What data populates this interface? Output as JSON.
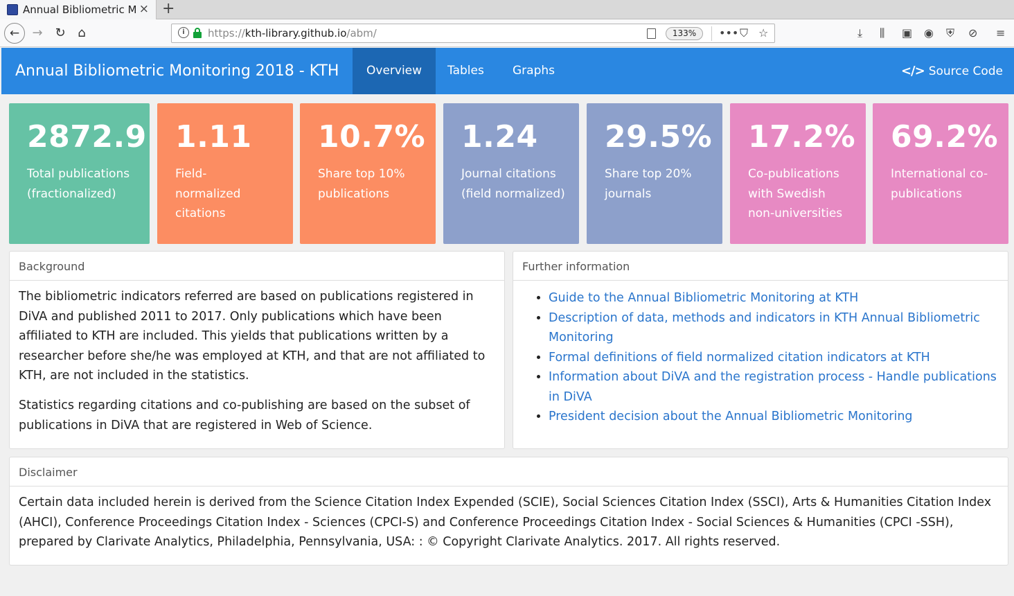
{
  "browser": {
    "tab_title": "Annual Bibliometric Monitoring 2018 - KTH",
    "tab_close": "×",
    "new_tab": "+",
    "url_scheme": "https://",
    "url_host": "kth-library.github.io",
    "url_path": "/abm/",
    "zoom": "133%"
  },
  "navbar": {
    "brand": "Annual Bibliometric Monitoring 2018 - KTH",
    "tabs": [
      {
        "label": "Overview",
        "active": true
      },
      {
        "label": "Tables",
        "active": false
      },
      {
        "label": "Graphs",
        "active": false
      }
    ],
    "source_code_label": "Source Code"
  },
  "value_boxes": [
    {
      "value": "2872.9",
      "label": "Total publications (fractionalized)",
      "color": "#66c2a5"
    },
    {
      "value": "1.11",
      "label": "Field-normalized citations",
      "color": "#fc8d62"
    },
    {
      "value": "10.7%",
      "label": "Share top 10% publications",
      "color": "#fc8d62"
    },
    {
      "value": "1.24",
      "label": "Journal citations (field normalized)",
      "color": "#8da0cb"
    },
    {
      "value": "29.5%",
      "label": "Share top 20% journals",
      "color": "#8da0cb"
    },
    {
      "value": "17.2%",
      "label": "Co-publications with Swedish non-universities",
      "color": "#e78ac3"
    },
    {
      "value": "69.2%",
      "label": "International co-publications",
      "color": "#e78ac3"
    }
  ],
  "background": {
    "heading": "Background",
    "paragraphs": [
      "The bibliometric indicators referred are based on publications registered in DiVA and published 2011 to 2017. Only publications which have been affiliated to KTH are included. This yields that publications written by a researcher before she/he was employed at KTH, and that are not affiliated to KTH, are not included in the statistics.",
      "Statistics regarding citations and co-publishing are based on the subset of publications in DiVA that are registered in Web of Science."
    ]
  },
  "further_info": {
    "heading": "Further information",
    "links": [
      "Guide to the Annual Bibliometric Monitoring at KTH",
      "Description of data, methods and indicators in KTH Annual Bibliometric Monitoring",
      "Formal definitions of field normalized citation indicators at KTH",
      "Information about DiVA and the registration process - Handle publications in DiVA",
      "President decision about the Annual Bibliometric Monitoring"
    ]
  },
  "disclaimer": {
    "heading": "Disclaimer",
    "text": "Certain data included herein is derived from the Science Citation Index Expended (SCIE), Social Sciences Citation Index (SSCI), Arts & Humanities Citation Index (AHCI), Conference Proceedings Citation Index - Sciences (CPCI-S) and Conference Proceedings Citation Index - Social Sciences & Humanities (CPCI -SSH), prepared by Clarivate Analytics, Philadelphia, Pennsylvania, USA: : © Copyright Clarivate Analytics. 2017. All rights reserved."
  },
  "colors": {
    "navbar": "#2a87e1",
    "navbar_active": "#1c67b3",
    "link": "#2a75cc"
  },
  "icons": {
    "back": "back-arrow-icon",
    "forward": "forward-arrow-icon",
    "reload": "reload-icon",
    "home": "home-icon",
    "source_code": "code-icon"
  }
}
